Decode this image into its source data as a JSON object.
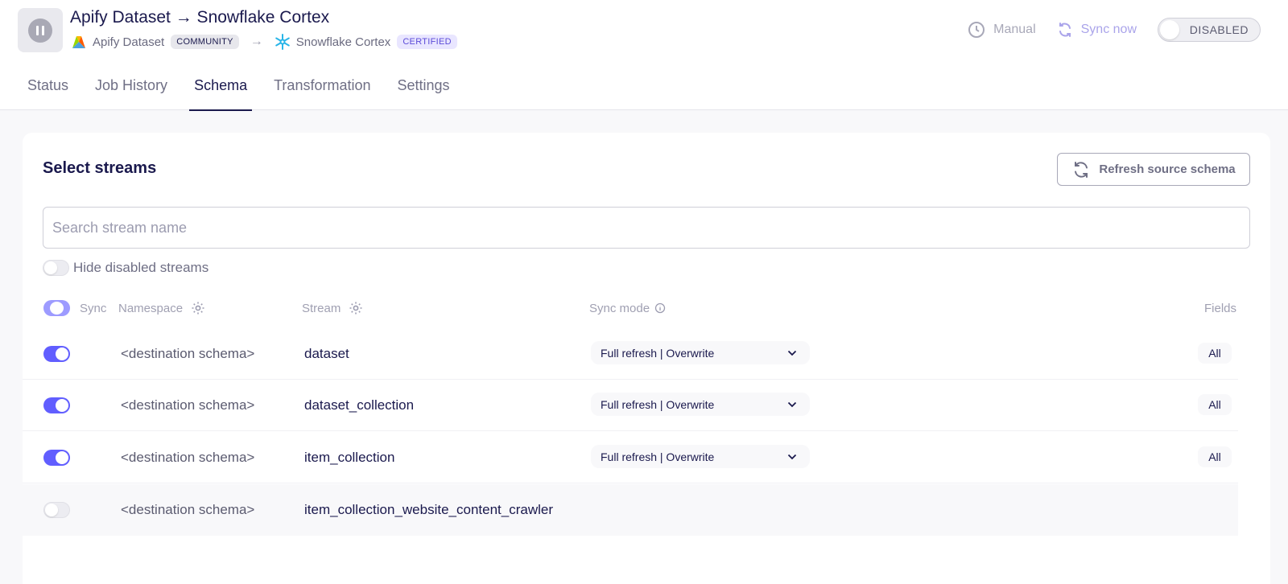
{
  "header": {
    "title": "Apify Dataset → Snowflake Cortex",
    "source": {
      "name": "Apify Dataset",
      "badge": "COMMUNITY"
    },
    "destination": {
      "name": "Snowflake Cortex",
      "badge": "CERTIFIED"
    },
    "schedule_label": "Manual",
    "sync_now_label": "Sync now",
    "enabled_state": "DISABLED"
  },
  "tabs": [
    {
      "label": "Status",
      "active": false
    },
    {
      "label": "Job History",
      "active": false
    },
    {
      "label": "Schema",
      "active": true
    },
    {
      "label": "Transformation",
      "active": false
    },
    {
      "label": "Settings",
      "active": false
    }
  ],
  "streams_section": {
    "title": "Select streams",
    "refresh_label": "Refresh source schema",
    "search_placeholder": "Search stream name",
    "hide_disabled_label": "Hide disabled streams",
    "columns": {
      "sync": "Sync",
      "namespace": "Namespace",
      "stream": "Stream",
      "sync_mode": "Sync mode",
      "fields": "Fields"
    },
    "rows": [
      {
        "enabled": true,
        "namespace": "<destination schema>",
        "stream": "dataset",
        "sync_mode": "Full refresh | Overwrite",
        "fields": "All"
      },
      {
        "enabled": true,
        "namespace": "<destination schema>",
        "stream": "dataset_collection",
        "sync_mode": "Full refresh | Overwrite",
        "fields": "All"
      },
      {
        "enabled": true,
        "namespace": "<destination schema>",
        "stream": "item_collection",
        "sync_mode": "Full refresh | Overwrite",
        "fields": "All"
      },
      {
        "enabled": false,
        "namespace": "<destination schema>",
        "stream": "item_collection_website_content_crawler",
        "sync_mode": "",
        "fields": ""
      }
    ]
  },
  "colors": {
    "accent": "#615eff",
    "text_primary": "#1a194d",
    "text_muted": "#6f6f85",
    "certified_bg": "#e9e6ff"
  },
  "icons": [
    "pause-icon",
    "apify-logo-icon",
    "arrow-right-icon",
    "snowflake-logo-icon",
    "clock-icon",
    "sync-icon",
    "refresh-icon",
    "gear-icon",
    "info-icon",
    "chevron-down-icon"
  ]
}
